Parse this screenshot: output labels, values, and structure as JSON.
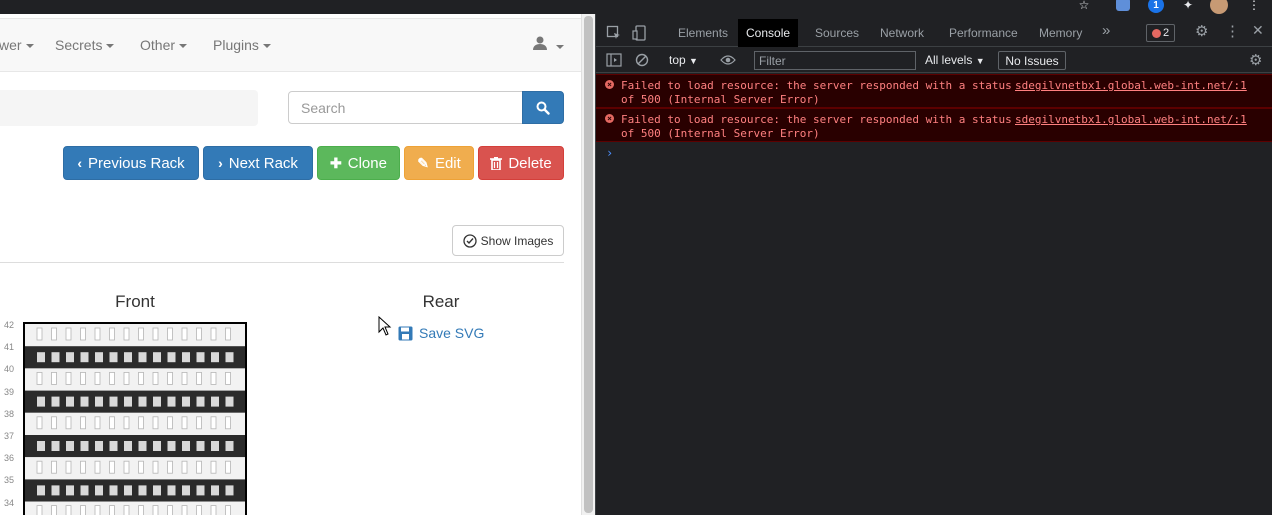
{
  "navbar": {
    "items": [
      {
        "label": "wer"
      },
      {
        "label": "Secrets"
      },
      {
        "label": "Other"
      },
      {
        "label": "Plugins"
      }
    ]
  },
  "search": {
    "placeholder": "Search"
  },
  "actions": {
    "previous_rack": "Previous Rack",
    "next_rack": "Next Rack",
    "clone": "Clone",
    "edit": "Edit",
    "delete": "Delete"
  },
  "show_images_label": "Show Images",
  "rack": {
    "front_title": "Front",
    "rear_title": "Rear",
    "save_svg_label": "Save SVG",
    "unit_numbers": [
      "42",
      "41",
      "40",
      "39",
      "38",
      "37",
      "36",
      "35",
      "34"
    ]
  },
  "devtools": {
    "tabs": [
      "Elements",
      "Console",
      "Sources",
      "Network",
      "Performance",
      "Memory"
    ],
    "active_tab": "Console",
    "error_count": "2",
    "context": "top",
    "filter_placeholder": "Filter",
    "levels_label": "All levels",
    "issues_label": "No Issues",
    "messages": [
      {
        "line1": "Failed to load resource: the server responded with a status",
        "line2": "of 500 (Internal Server Error)",
        "source": "sdegilvnetbx1.global.web-int.net/:1"
      },
      {
        "line1": "Failed to load resource: the server responded with a status",
        "line2": "of 500 (Internal Server Error)",
        "source": "sdegilvnetbx1.global.web-int.net/:1"
      }
    ],
    "prompt_symbol": "›"
  },
  "colors": {
    "primary": "#337ab7",
    "success": "#5cb85c",
    "warning": "#f0ad4e",
    "danger": "#d9534f",
    "console_error_bg": "#290000",
    "console_error_text": "#ff8080"
  }
}
